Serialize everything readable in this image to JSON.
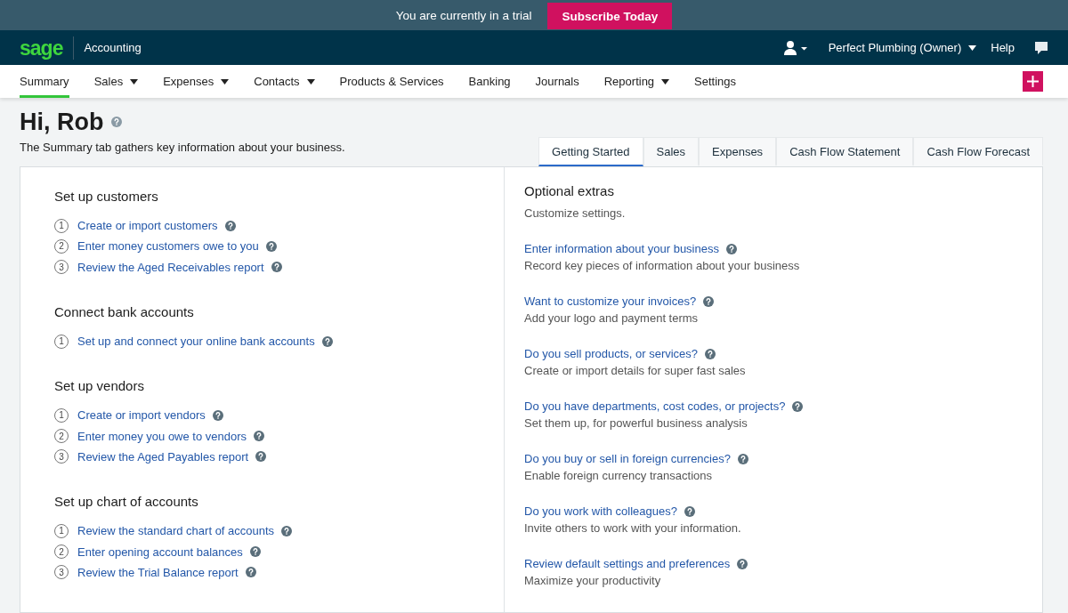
{
  "trial_bar": {
    "message": "You are currently in a trial",
    "button": "Subscribe Today"
  },
  "header": {
    "logo": "sage",
    "product": "Accounting",
    "account": "Perfect Plumbing (Owner)",
    "help": "Help"
  },
  "nav": {
    "items": [
      {
        "label": "Summary",
        "selected": true,
        "dropdown": false
      },
      {
        "label": "Sales",
        "selected": false,
        "dropdown": true
      },
      {
        "label": "Expenses",
        "selected": false,
        "dropdown": true
      },
      {
        "label": "Contacts",
        "selected": false,
        "dropdown": true
      },
      {
        "label": "Products & Services",
        "selected": false,
        "dropdown": false
      },
      {
        "label": "Banking",
        "selected": false,
        "dropdown": false
      },
      {
        "label": "Journals",
        "selected": false,
        "dropdown": false
      },
      {
        "label": "Reporting",
        "selected": false,
        "dropdown": true
      },
      {
        "label": "Settings",
        "selected": false,
        "dropdown": false
      }
    ]
  },
  "page": {
    "greeting": "Hi, Rob",
    "subtitle": "The Summary tab gathers key information about your business."
  },
  "tabs": [
    {
      "label": "Getting Started",
      "selected": true
    },
    {
      "label": "Sales",
      "selected": false
    },
    {
      "label": "Expenses",
      "selected": false
    },
    {
      "label": "Cash Flow Statement",
      "selected": false
    },
    {
      "label": "Cash Flow Forecast",
      "selected": false
    }
  ],
  "setup_sections": [
    {
      "title": "Set up customers",
      "steps": [
        {
          "number": "1",
          "label": "Create or import customers"
        },
        {
          "number": "2",
          "label": "Enter money customers owe to you"
        },
        {
          "number": "3",
          "label": "Review the Aged Receivables report"
        }
      ]
    },
    {
      "title": "Connect bank accounts",
      "steps": [
        {
          "number": "1",
          "label": "Set up and connect your online bank accounts"
        }
      ]
    },
    {
      "title": "Set up vendors",
      "steps": [
        {
          "number": "1",
          "label": "Create or import vendors"
        },
        {
          "number": "2",
          "label": "Enter money you owe to vendors"
        },
        {
          "number": "3",
          "label": "Review the Aged Payables report"
        }
      ]
    },
    {
      "title": "Set up chart of accounts",
      "steps": [
        {
          "number": "1",
          "label": "Review the standard chart of accounts"
        },
        {
          "number": "2",
          "label": "Enter opening account balances"
        },
        {
          "number": "3",
          "label": "Review the Trial Balance report"
        }
      ]
    }
  ],
  "optional_extras": {
    "title": "Optional extras",
    "subtitle": "Customize settings.",
    "items": [
      {
        "link": "Enter information about your business",
        "description": "Record key pieces of information about your business"
      },
      {
        "link": "Want to customize your invoices?",
        "description": "Add your logo and payment terms"
      },
      {
        "link": "Do you sell products, or services?",
        "description": "Create or import details for super fast sales"
      },
      {
        "link": "Do you have departments, cost codes, or projects?",
        "description": "Set them up, for powerful business analysis"
      },
      {
        "link": "Do you buy or sell in foreign currencies?",
        "description": "Enable foreign currency transactions"
      },
      {
        "link": "Do you work with colleagues?",
        "description": "Invite others to work with your information."
      },
      {
        "link": "Review default settings and preferences",
        "description": "Maximize your productivity"
      }
    ]
  }
}
